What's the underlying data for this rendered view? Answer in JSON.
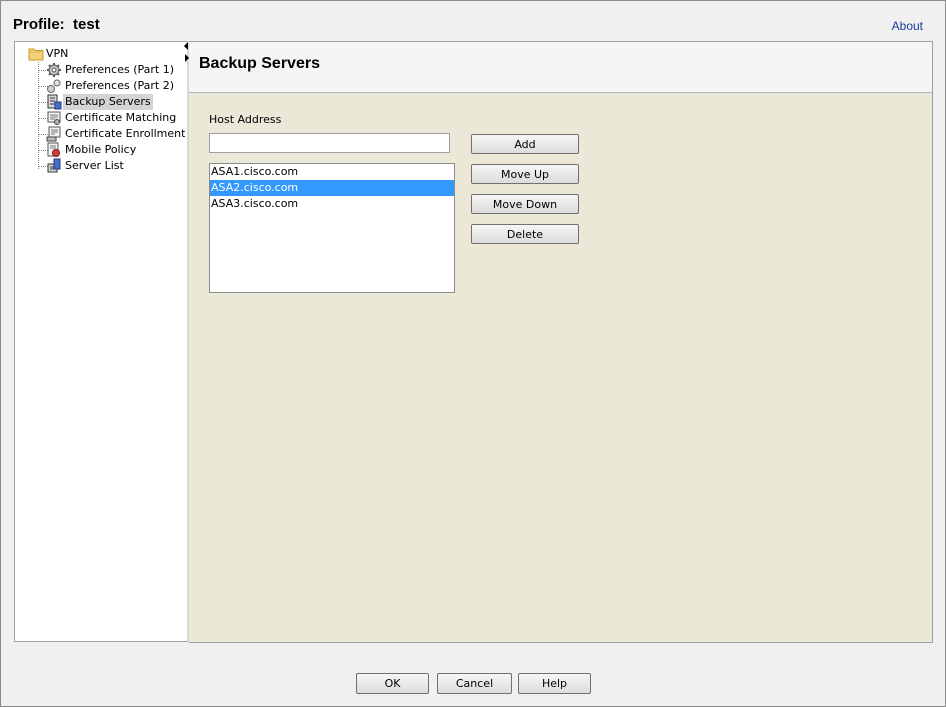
{
  "header": {
    "profile_label": "Profile:",
    "profile_name": "test",
    "about_label": "About"
  },
  "tree": {
    "root_label": "VPN",
    "items": [
      {
        "label": "Preferences (Part 1)",
        "icon": "gear-icon",
        "selected": false
      },
      {
        "label": "Preferences (Part 2)",
        "icon": "gears-icon",
        "selected": false
      },
      {
        "label": "Backup Servers",
        "icon": "server-icon",
        "selected": true
      },
      {
        "label": "Certificate Matching",
        "icon": "certificate-icon",
        "selected": false
      },
      {
        "label": "Certificate Enrollment",
        "icon": "certificate-enroll-icon",
        "selected": false
      },
      {
        "label": "Mobile Policy",
        "icon": "mobile-policy-icon",
        "selected": false
      },
      {
        "label": "Server List",
        "icon": "server-list-icon",
        "selected": false
      }
    ]
  },
  "main": {
    "title": "Backup Servers",
    "host_address_label": "Host Address",
    "host_address_value": "",
    "servers": [
      {
        "name": "ASA1.cisco.com",
        "selected": false
      },
      {
        "name": "ASA2.cisco.com",
        "selected": true
      },
      {
        "name": "ASA3.cisco.com",
        "selected": false
      }
    ],
    "buttons": {
      "add": "Add",
      "move_up": "Move Up",
      "move_down": "Move Down",
      "delete": "Delete"
    }
  },
  "footer": {
    "ok": "OK",
    "cancel": "Cancel",
    "help": "Help"
  },
  "colors": {
    "selection": "#3399ff",
    "panel_bg": "#ebe8d8",
    "link": "#1a3a9c"
  }
}
